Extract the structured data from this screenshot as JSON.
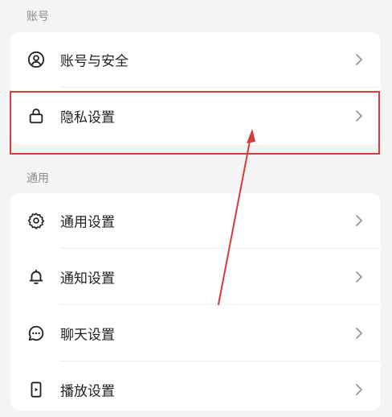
{
  "sections": {
    "account": {
      "title": "账号",
      "items": [
        {
          "label": "账号与安全",
          "icon": "user-circle-icon"
        },
        {
          "label": "隐私设置",
          "icon": "lock-icon"
        }
      ]
    },
    "general": {
      "title": "通用",
      "items": [
        {
          "label": "通用设置",
          "icon": "gear-icon"
        },
        {
          "label": "通知设置",
          "icon": "bell-icon"
        },
        {
          "label": "聊天设置",
          "icon": "chat-bubble-icon"
        },
        {
          "label": "播放设置",
          "icon": "phone-play-icon"
        }
      ]
    }
  },
  "colors": {
    "highlight": "#e0393a",
    "arrow": "#d83a3a"
  }
}
